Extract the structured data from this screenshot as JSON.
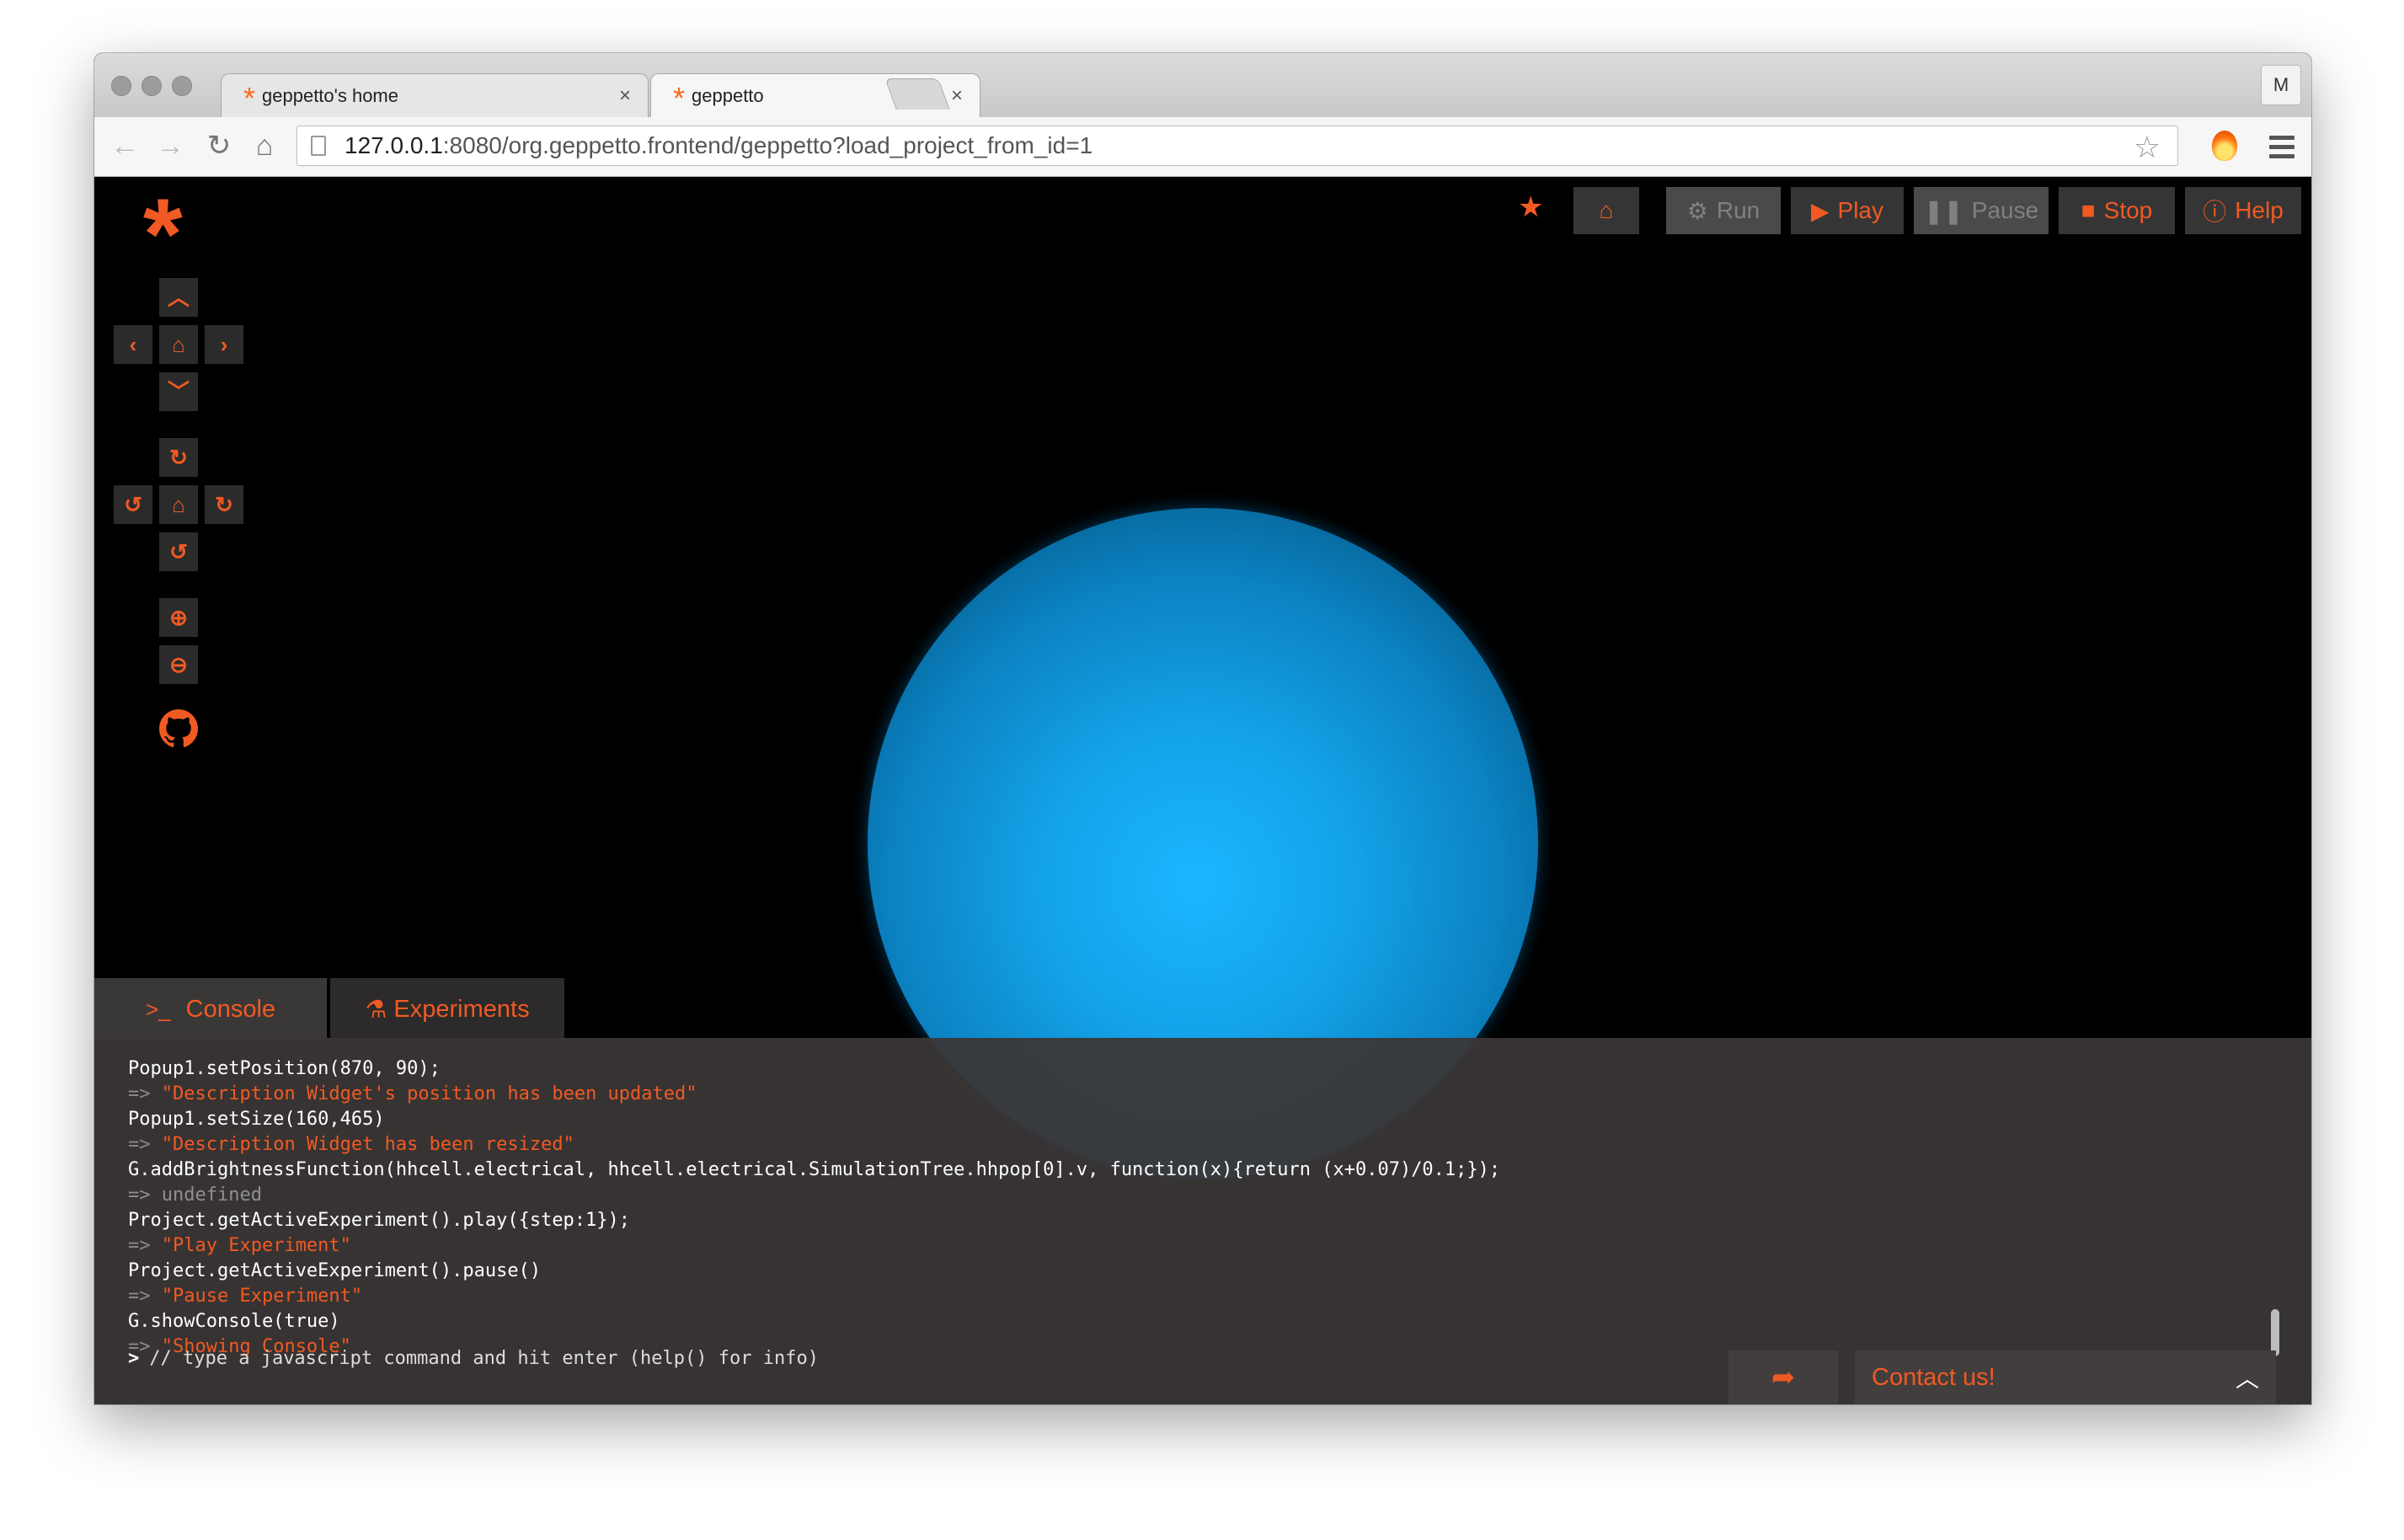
{
  "browser": {
    "tabs": [
      {
        "title": "geppetto's home",
        "close": "×"
      },
      {
        "title": "geppetto",
        "close": "×"
      }
    ],
    "profile_initial": "M",
    "url_host": "127.0.0.1",
    "url_rest": ":8080/org.geppetto.frontend/geppetto?load_project_from_id=1"
  },
  "toolbar": {
    "run_label": "Run",
    "play_label": "Play",
    "pause_label": "Pause",
    "stop_label": "Stop",
    "help_label": "Help"
  },
  "console_tabs": {
    "console_label": "Console",
    "console_icon_text": ">_",
    "experiments_label": "Experiments"
  },
  "console": {
    "lines": [
      {
        "type": "cmd",
        "text": "Popup1.setPosition(870, 90);"
      },
      {
        "type": "res",
        "text": "\"Description Widget's position has been updated\""
      },
      {
        "type": "cmd",
        "text": "Popup1.setSize(160,465)"
      },
      {
        "type": "res",
        "text": "\"Description Widget has been resized\""
      },
      {
        "type": "cmd",
        "text": "G.addBrightnessFunction(hhcell.electrical, hhcell.electrical.SimulationTree.hhpop[0].v, function(x){return (x+0.07)/0.1;});"
      },
      {
        "type": "undef",
        "text": "=> undefined"
      },
      {
        "type": "cmd",
        "text": "Project.getActiveExperiment().play({step:1});"
      },
      {
        "type": "res",
        "text": "\"Play Experiment\""
      },
      {
        "type": "cmd",
        "text": "Project.getActiveExperiment().pause()"
      },
      {
        "type": "res",
        "text": "\"Pause Experiment\""
      },
      {
        "type": "cmd",
        "text": "G.showConsole(true)"
      },
      {
        "type": "res",
        "text": "\"Showing Console\""
      }
    ],
    "result_arrow": "=>",
    "prompt_caret": ">",
    "prompt_placeholder": "// type a javascript command and hit enter (help() for info)"
  },
  "contact": {
    "label": "Contact us!"
  },
  "colors": {
    "accent": "#f15a22",
    "sphere": "#1bb6ff",
    "console_bg": "#3a3636"
  },
  "icons": [
    "geppetto-logo-icon",
    "pan-up-icon",
    "pan-left-icon",
    "pan-home-icon",
    "pan-right-icon",
    "pan-down-icon",
    "rotate-up-icon",
    "rotate-left-icon",
    "rotate-home-icon",
    "rotate-right-icon",
    "rotate-down-icon",
    "zoom-in-icon",
    "zoom-out-icon",
    "github-icon",
    "star-icon",
    "home-icon",
    "gears-icon",
    "play-icon",
    "pause-icon",
    "stop-icon",
    "info-icon",
    "flask-icon",
    "share-icon",
    "chevron-up-icon"
  ]
}
